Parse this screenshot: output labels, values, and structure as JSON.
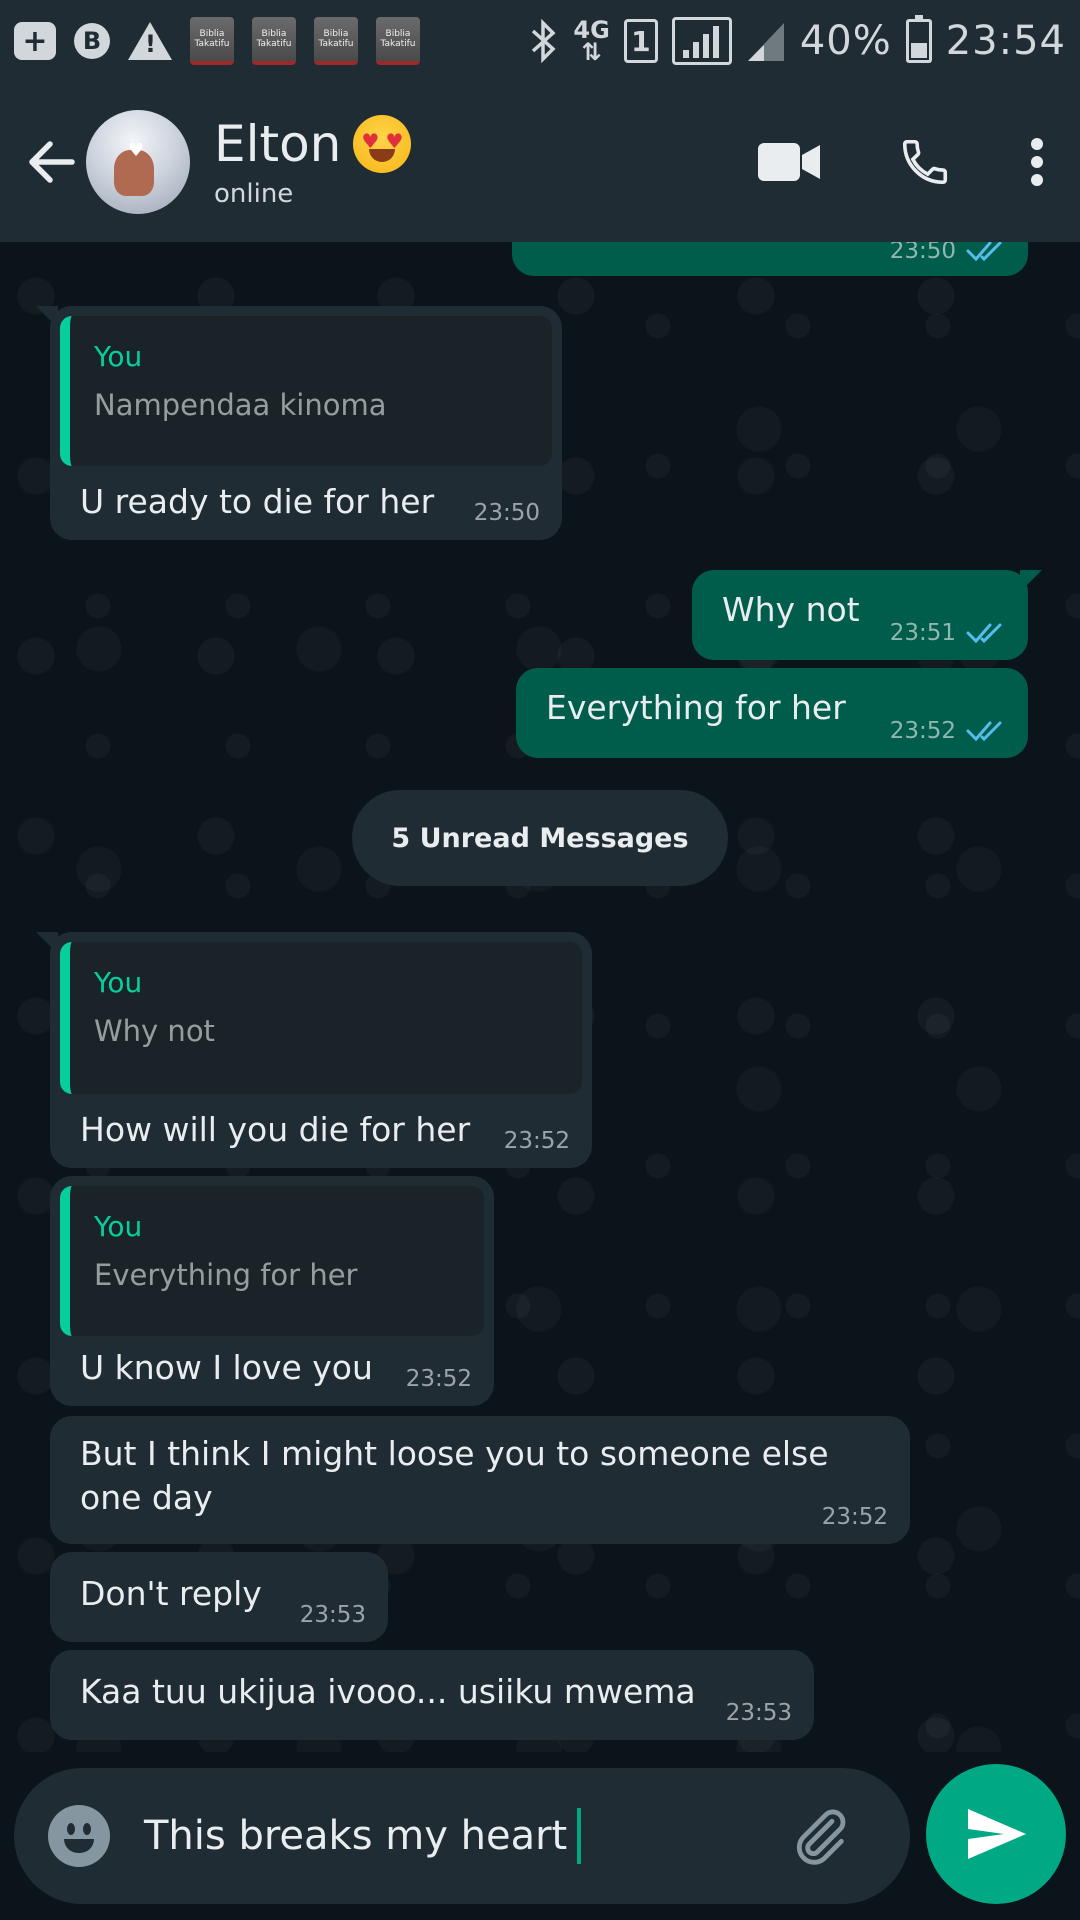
{
  "status_bar": {
    "network": "4G",
    "sim": "1",
    "battery": "40%",
    "battery_level": 0.4,
    "time": "23:54",
    "b_badge": "B",
    "book_label": "Biblia Takatifu"
  },
  "header": {
    "contact_name": "Elton",
    "status": "online"
  },
  "messages": [
    {
      "id": "m0",
      "direction": "out",
      "text": "",
      "time": "23:50",
      "ticks": "read"
    },
    {
      "id": "m1",
      "direction": "in",
      "quote_author": "You",
      "quote_text": "Nampendaa kinoma",
      "text": "U ready to die for her",
      "time": "23:50"
    },
    {
      "id": "m2",
      "direction": "out",
      "text": "Why not",
      "time": "23:51",
      "ticks": "read"
    },
    {
      "id": "m3",
      "direction": "out",
      "text": "Everything for her",
      "time": "23:52",
      "ticks": "read"
    },
    {
      "id": "m4",
      "direction": "in",
      "quote_author": "You",
      "quote_text": "Why not",
      "text": "How will you die for her",
      "time": "23:52"
    },
    {
      "id": "m5",
      "direction": "in",
      "quote_author": "You",
      "quote_text": "Everything for her",
      "text": "U know I love you",
      "time": "23:52"
    },
    {
      "id": "m6",
      "direction": "in",
      "text_line1": "But I think I might loose you to someone else",
      "text_line2": "one day",
      "time": "23:52"
    },
    {
      "id": "m7",
      "direction": "in",
      "text": "Don't reply",
      "time": "23:53"
    },
    {
      "id": "m8",
      "direction": "in",
      "text": "Kaa tuu ukijua ivooo... usiiku mwema",
      "time": "23:53"
    }
  ],
  "unread_divider": "5 Unread Messages",
  "composer": {
    "text": "This breaks my heart"
  },
  "colors": {
    "background": "#0b141a",
    "header": "#1f2c34",
    "incoming_bubble": "#202c33",
    "outgoing_bubble": "#005c4b",
    "accent": "#00a884",
    "quote_author": "#06cf9c",
    "read_ticks": "#53bdeb"
  },
  "icons": {
    "back": "arrow-left-icon",
    "video": "video-camera-icon",
    "call": "phone-icon",
    "menu": "more-vertical-icon",
    "emoji": "emoji-icon",
    "attach": "paperclip-icon",
    "send": "send-icon"
  }
}
